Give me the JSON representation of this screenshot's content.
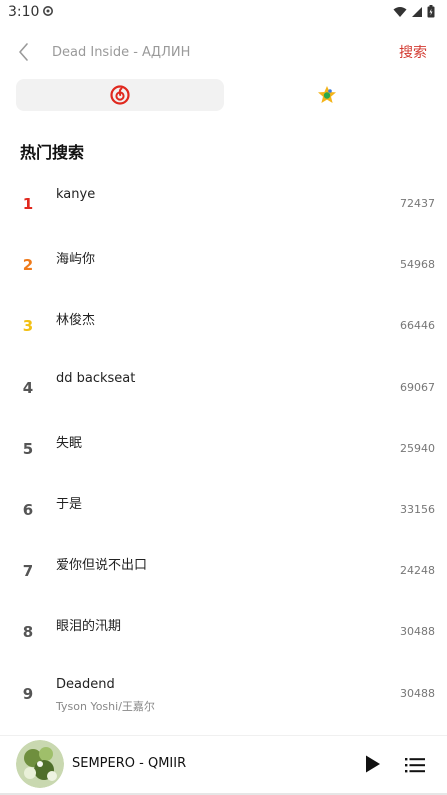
{
  "status": {
    "time": "3:10"
  },
  "header": {
    "search_placeholder": "Dead Inside - АДЛИН",
    "search_button": "搜索"
  },
  "source_tabs": [
    {
      "icon": "netease-music-icon",
      "active": true,
      "color": "#e0281e"
    },
    {
      "icon": "qq-music-icon",
      "active": false,
      "color": "#f4b41a"
    }
  ],
  "section": {
    "title": "热门搜索"
  },
  "hot_list": [
    {
      "rank": "1",
      "keyword": "kanye",
      "count": "72437",
      "rank_color": "#e0281e"
    },
    {
      "rank": "2",
      "keyword": "海屿你",
      "count": "54968",
      "rank_color": "#ef7a1a"
    },
    {
      "rank": "3",
      "keyword": "林俊杰",
      "count": "66446",
      "rank_color": "#f2c014"
    },
    {
      "rank": "4",
      "keyword": "dd backseat",
      "count": "69067"
    },
    {
      "rank": "5",
      "keyword": "失眠",
      "count": "25940"
    },
    {
      "rank": "6",
      "keyword": "于是",
      "count": "33156"
    },
    {
      "rank": "7",
      "keyword": "爱你但说不出口",
      "count": "24248"
    },
    {
      "rank": "8",
      "keyword": "眼泪的汛期",
      "count": "30488"
    },
    {
      "rank": "9",
      "keyword": "Deadend",
      "sub": "Tyson Yoshi/王嘉尔",
      "count": "30488"
    }
  ],
  "player": {
    "track": "SEMPERO - QMIIR"
  },
  "colors": {
    "accent": "#d33a31"
  }
}
